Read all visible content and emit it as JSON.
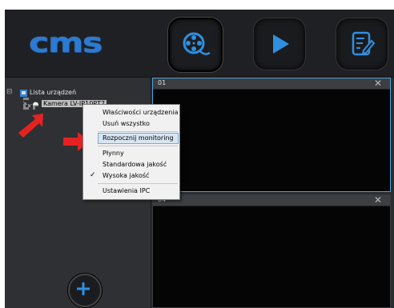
{
  "toolbar": {
    "logo_text": "cms",
    "buttons": [
      {
        "icon": "film-reel-icon",
        "active": true
      },
      {
        "icon": "play-icon",
        "active": false
      },
      {
        "icon": "edit-document-icon",
        "active": false
      }
    ],
    "accent_color": "#2f8fe0"
  },
  "device_tree": {
    "root_label": "Lista urządzeń",
    "device_label": "Kamera LV-IP10PT7"
  },
  "grid": {
    "cells": [
      {
        "number": "01",
        "close": "✕",
        "selected": true
      },
      {
        "number": "04",
        "close": "✕",
        "selected": false
      }
    ]
  },
  "context_menu": {
    "items": [
      {
        "label": "Właściwości urządzenia"
      },
      {
        "label": "Usuń wszystko"
      },
      {
        "label": "Rozpocznij monitoring",
        "highlighted": true
      },
      {
        "label": "Płynny"
      },
      {
        "label": "Standardowa jakość"
      },
      {
        "label": "Wysoka jakość",
        "checked": true
      },
      {
        "label": "Ustawienia IPC"
      }
    ],
    "check_mark": "✓"
  },
  "add_button": {
    "icon": "plus-icon",
    "symbol": "+"
  },
  "annotations": {
    "arrow_color": "#e52222"
  }
}
